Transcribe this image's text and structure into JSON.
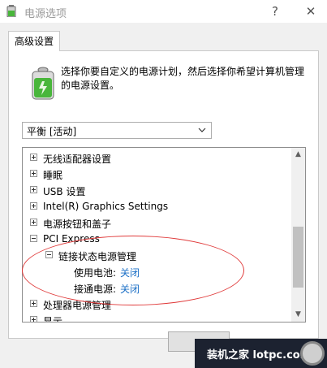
{
  "window": {
    "title": "电源选项",
    "minimize_glyph": "?",
    "close_glyph": "✕"
  },
  "tabs": [
    {
      "label": "高级设置"
    }
  ],
  "description": "选择你要自定义的电源计划，然后选择你希望计算机管理的电源设置。",
  "plan_select": {
    "value": "平衡 [活动]"
  },
  "tree": {
    "items": [
      {
        "label": "无线适配器设置",
        "state": "collapsed"
      },
      {
        "label": "睡眠",
        "state": "collapsed"
      },
      {
        "label": "USB 设置",
        "state": "collapsed"
      },
      {
        "label": "Intel(R) Graphics Settings",
        "state": "collapsed"
      },
      {
        "label": "电源按钮和盖子",
        "state": "collapsed"
      },
      {
        "label": "PCI Express",
        "state": "expanded"
      },
      {
        "label": "链接状态电源管理",
        "state": "expanded"
      },
      {
        "label": "使用电池:",
        "value": "关闭"
      },
      {
        "label": "接通电源:",
        "value": "关闭"
      },
      {
        "label": "处理器电源管理",
        "state": "collapsed"
      },
      {
        "label": "显示",
        "state": "collapsed"
      }
    ]
  },
  "watermark": {
    "text": "装机之家 lotpc.com"
  },
  "colors": {
    "link": "#1b6fc6",
    "highlight_ellipse": "#e03b3b",
    "battery": "#49b63b"
  }
}
